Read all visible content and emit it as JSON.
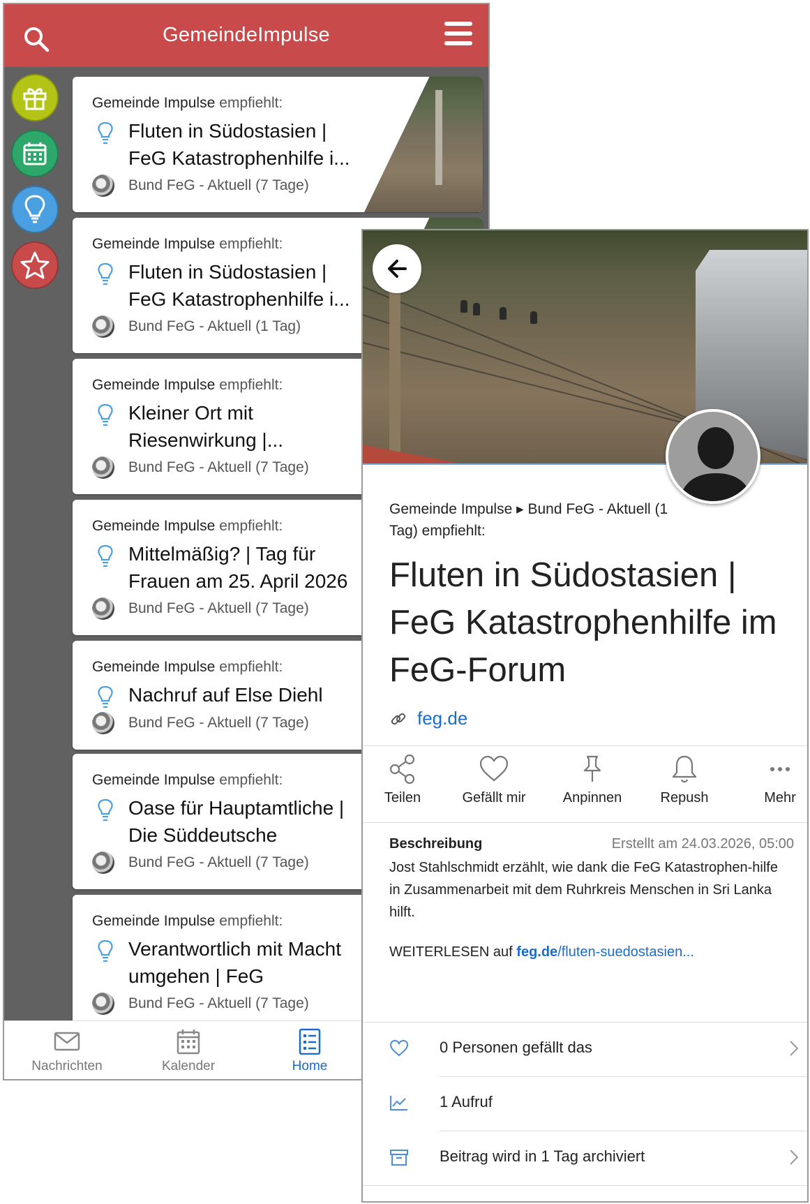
{
  "app": {
    "title": "GemeindeImpulse"
  },
  "rail": [
    {
      "name": "gift-icon",
      "color": "#b4c417"
    },
    {
      "name": "calendar-icon",
      "color": "#2ea86a"
    },
    {
      "name": "lightbulb-icon",
      "color": "#4a9fe0"
    },
    {
      "name": "star-icon",
      "color": "#c94a4a"
    }
  ],
  "feed": [
    {
      "recommender": "Gemeinde Impulse",
      "recommends": "empfiehlt:",
      "title": "Fluten in Südostasien | FeG Katastrophenhilfe i...",
      "source": "Bund FeG - Aktuell (7 Tage)"
    },
    {
      "recommender": "Gemeinde Impulse",
      "recommends": "empfiehlt:",
      "title": "Fluten in Südostasien | FeG Katastrophenhilfe i...",
      "source": "Bund FeG - Aktuell (1 Tag)"
    },
    {
      "recommender": "Gemeinde Impulse",
      "recommends": "empfiehlt:",
      "title": "Kleiner Ort mit Riesenwirkung |...",
      "source": "Bund FeG - Aktuell (7 Tage)"
    },
    {
      "recommender": "Gemeinde Impulse",
      "recommends": "empfiehlt:",
      "title": "Mittelmäßig? | Tag für Frauen am 25. April 2026",
      "source": "Bund FeG - Aktuell (7 Tage)"
    },
    {
      "recommender": "Gemeinde Impulse",
      "recommends": "empfiehlt:",
      "title": "Nachruf auf Else Diehl",
      "source": "Bund FeG - Aktuell (7 Tage)"
    },
    {
      "recommender": "Gemeinde Impulse",
      "recommends": "empfiehlt:",
      "title": "Oase für Hauptamtliche | Die Süddeutsche",
      "source": "Bund FeG - Aktuell (7 Tage)"
    },
    {
      "recommender": "Gemeinde Impulse",
      "recommends": "empfiehlt:",
      "title": "Verantwortlich mit Macht umgehen | FeG Seelsorg...",
      "source": "Bund FeG - Aktuell (7 Tage)"
    }
  ],
  "bottomnav": {
    "messages": "Nachrichten",
    "calendar": "Kalender",
    "home": "Home"
  },
  "detail": {
    "recommendation": "Gemeinde Impulse ▸ Bund FeG - Aktuell (1 Tag) empfiehlt:",
    "title": "Fluten in Südostasien | FeG Katastrophenhilfe im FeG-Forum",
    "link": "feg.de",
    "actions": {
      "share": "Teilen",
      "like": "Gefällt mir",
      "pin": "Anpinnen",
      "repush": "Repush",
      "more": "Mehr"
    },
    "description": {
      "heading": "Beschreibung",
      "created": "Erstellt am 24.03.2026, 05:00",
      "text": "Jost Stahlschmidt erzählt, wie dank die FeG Katastrophen-hilfe in Zusammenarbeit mit dem Ruhrkreis Menschen in Sri Lanka hilft.",
      "readmore_prefix": "WEITERLESEN auf ",
      "readmore_domain": "feg.de",
      "readmore_path": "/fluten-suedostasien..."
    },
    "stats": {
      "likes": "0 Personen gefällt das",
      "views": "1 Aufruf",
      "archive": "Beitrag wird in 1 Tag archiviert"
    }
  },
  "colors": {
    "topbar": "#c94a4a",
    "accent": "#1a6ccf",
    "background": "#616161"
  }
}
